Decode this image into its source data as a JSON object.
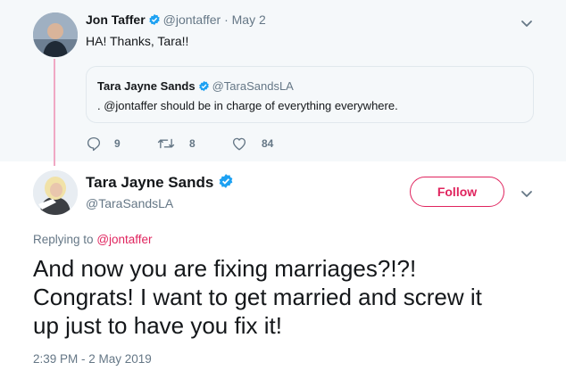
{
  "parent_tweet": {
    "author_name": "Jon Taffer",
    "author_handle": "@jontaffer",
    "separator": "·",
    "date": "May 2",
    "text": "HA! Thanks, Tara!!",
    "quoted": {
      "author_name": "Tara Jayne Sands",
      "author_handle": "@TaraSandsLA",
      "text": ". @jontaffer should be in charge of everything everywhere."
    },
    "actions": {
      "replies": "9",
      "retweets": "8",
      "likes": "84"
    }
  },
  "main_tweet": {
    "author_name": "Tara Jayne Sands",
    "author_handle": "@TaraSandsLA",
    "follow_label": "Follow",
    "replying_prefix": "Replying to",
    "replying_to": "@jontaffer",
    "text_lines": [
      "And now you are fixing marriages?!?!",
      "Congrats! I want to get married and screw it",
      "up just to have you fix it!"
    ],
    "timestamp": "2:39 PM - 2 May 2019"
  },
  "colors": {
    "accent": "#e0245e",
    "verified": "#1da1f2",
    "muted_text": "#657786",
    "thread_line": "#f0a8c4",
    "top_background": "#f5f8fa"
  },
  "icons": [
    "verified-badge-icon",
    "chevron-down-icon",
    "reply-icon",
    "retweet-icon",
    "like-icon"
  ]
}
